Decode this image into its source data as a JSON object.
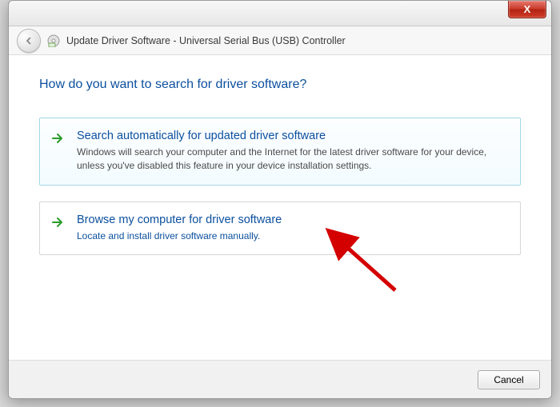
{
  "window": {
    "title": "Update Driver Software - Universal Serial Bus (USB) Controller"
  },
  "heading": "How do you want to search for driver software?",
  "options": [
    {
      "title": "Search automatically for updated driver software",
      "desc": "Windows will search your computer and the Internet for the latest driver software for your device, unless you've disabled this feature in your device installation settings."
    },
    {
      "title": "Browse my computer for driver software",
      "desc": "Locate and install driver software manually."
    }
  ],
  "footer": {
    "cancel": "Cancel"
  },
  "close_glyph": "X"
}
